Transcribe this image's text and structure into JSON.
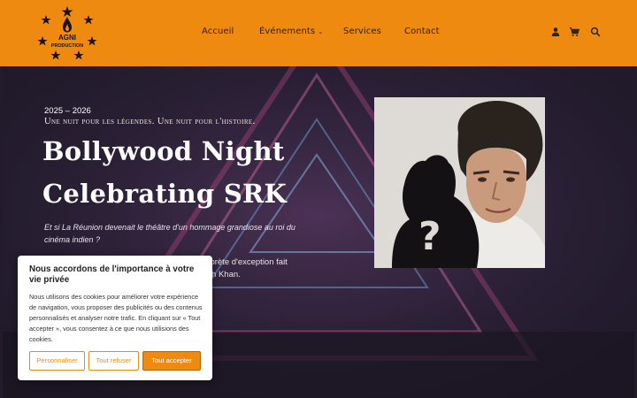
{
  "brand": {
    "name_line1": "AGNI",
    "name_line2": "PRODUCTION",
    "accent_color": "#ee8a10"
  },
  "nav": {
    "items": [
      {
        "label": "Accueil"
      },
      {
        "label": "Événements"
      },
      {
        "label": "Services"
      },
      {
        "label": "Contact"
      }
    ],
    "events_chevron": "⌄"
  },
  "header_icons": [
    "user-icon",
    "cart-icon",
    "search-icon"
  ],
  "hero": {
    "season": "2025 – 2026",
    "tagline": "Une nuit pour les légendes. Une nuit pour l'histoire.",
    "title": "Bollywood Night Celebrating SRK",
    "intro": " Et si La Réunion devenait le théâtre d'un hommage grandiose au roi du cinéma indien ?",
    "body": "erprète d'exception fait",
    "body2": "ukh Khan.",
    "fragment": "",
    "photo_mystery_mark": "?"
  },
  "cookie": {
    "title": "Nous accordons de l'importance à votre vie privée",
    "text": "Nous utilisons des cookies pour améliorer votre expérience de navigation, vous proposer des publicités ou des contenus personnalisés et analyser notre trafic. En cliquant sur « Tout accepter », vous consentez à ce que nous utilisions des cookies.",
    "customize_label": "Personnaliser",
    "refuse_label": "Tout refuser",
    "accept_label": "Tout accepter"
  }
}
